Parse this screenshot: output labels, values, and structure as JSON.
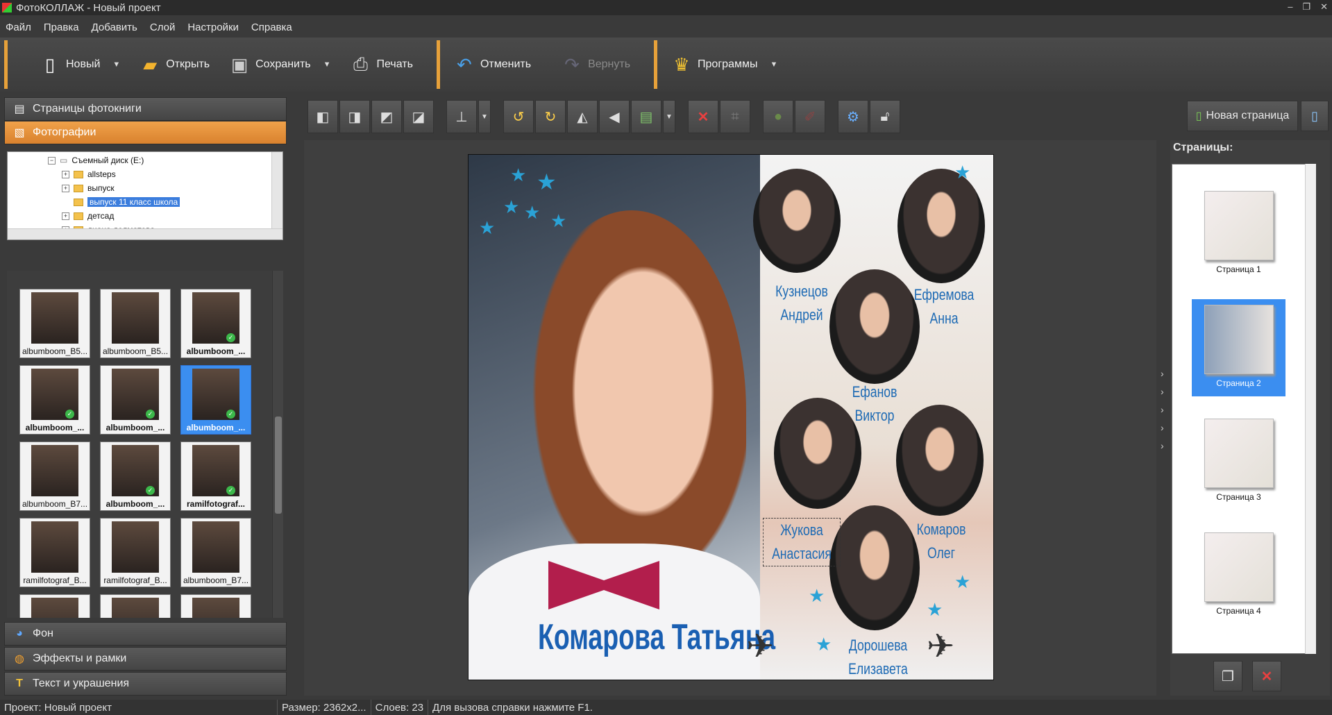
{
  "window": {
    "title": "ФотоКОЛЛАЖ - Новый проект"
  },
  "menu": [
    "Файл",
    "Правка",
    "Добавить",
    "Слой",
    "Настройки",
    "Справка"
  ],
  "toolbar": {
    "new": "Новый",
    "open": "Открыть",
    "save": "Сохранить",
    "print": "Печать",
    "undo": "Отменить",
    "redo": "Вернуть",
    "programs": "Программы"
  },
  "left": {
    "sections": {
      "book": "Страницы фотокниги",
      "photos": "Фотографии",
      "bg": "Фон",
      "effects": "Эффекты и рамки",
      "text": "Текст и украшения"
    },
    "tree": {
      "drive": "Съемный диск (E:)",
      "items": [
        "allsteps",
        "выпуск",
        "выпуск 11 класс школа",
        "детсад",
        "диана долматова"
      ]
    },
    "thumbs": [
      {
        "label": "albumboom_B5...",
        "bold": false,
        "checked": false,
        "selected": false
      },
      {
        "label": "albumboom_B5...",
        "bold": false,
        "checked": false,
        "selected": false
      },
      {
        "label": "albumboom_...",
        "bold": true,
        "checked": true,
        "selected": false
      },
      {
        "label": "albumboom_...",
        "bold": true,
        "checked": true,
        "selected": false
      },
      {
        "label": "albumboom_...",
        "bold": true,
        "checked": true,
        "selected": false
      },
      {
        "label": "albumboom_...",
        "bold": true,
        "checked": true,
        "selected": true
      },
      {
        "label": "albumboom_B7...",
        "bold": false,
        "checked": false,
        "selected": false
      },
      {
        "label": "albumboom_...",
        "bold": true,
        "checked": true,
        "selected": false
      },
      {
        "label": "ramilfotograf...",
        "bold": true,
        "checked": true,
        "selected": false
      },
      {
        "label": "ramilfotograf_B...",
        "bold": false,
        "checked": false,
        "selected": false
      },
      {
        "label": "ramilfotograf_B...",
        "bold": false,
        "checked": false,
        "selected": false
      },
      {
        "label": "albumboom_B7...",
        "bold": false,
        "checked": false,
        "selected": false
      }
    ]
  },
  "newpage": "Новая страница",
  "canvas": {
    "main_name": "Комарова Татьяна",
    "names": [
      "Кузнецов\nАндрей",
      "Ефремова\nАнна",
      "Ефанов\nВиктор",
      "Жукова\nАнастасия",
      "Комаров\nОлег",
      "Дорошева\nЕлизавета"
    ]
  },
  "pages": {
    "title": "Страницы:",
    "items": [
      "Страница 1",
      "Страница 2",
      "Страница 3",
      "Страница 4"
    ]
  },
  "status": {
    "project": "Проект:  Новый проект",
    "size": "Размер:  2362x2...",
    "layers": "Слоев:  23",
    "help": "Для вызова справки нажмите F1."
  }
}
